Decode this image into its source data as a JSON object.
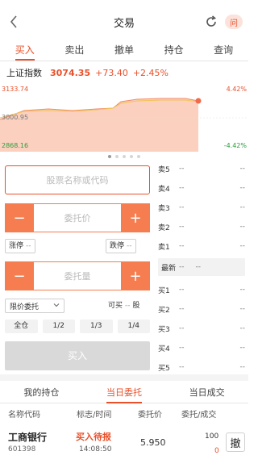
{
  "nav": {
    "title": "交易",
    "help_label": "问"
  },
  "tabs": [
    "买入",
    "卖出",
    "撤单",
    "持仓",
    "查询"
  ],
  "index": {
    "name": "上证指数",
    "value": "3074.35",
    "change": "+73.40",
    "percent": "+2.45%"
  },
  "chart_labels": {
    "y_top": "3133.74",
    "y_mid": "3000.95",
    "y_bottom": "2868.16",
    "pct_top": "4.42%",
    "pct_bottom": "-4.42%"
  },
  "form": {
    "stock_placeholder": "股票名称或代码",
    "price_placeholder": "委托价",
    "limit_up_label": "涨停",
    "limit_up_value": "--",
    "limit_down_label": "跌停",
    "limit_down_value": "--",
    "qty_placeholder": "委托量",
    "order_type": "限价委托",
    "can_buy_label": "可买",
    "can_buy_value": "--",
    "can_buy_unit": "股",
    "quick": [
      "全仓",
      "1/2",
      "1/3",
      "1/4"
    ],
    "buy_label": "买入"
  },
  "orderbook": {
    "sell": [
      {
        "n": "卖5",
        "p": "--",
        "v": "--"
      },
      {
        "n": "卖4",
        "p": "--",
        "v": "--"
      },
      {
        "n": "卖3",
        "p": "--",
        "v": "--"
      },
      {
        "n": "卖2",
        "p": "--",
        "v": "--"
      },
      {
        "n": "卖1",
        "p": "--",
        "v": "--"
      }
    ],
    "latest_label": "最新",
    "latest_v1": "--",
    "latest_v2": "--",
    "buy": [
      {
        "n": "买1",
        "p": "--",
        "v": "--"
      },
      {
        "n": "买2",
        "p": "--",
        "v": "--"
      },
      {
        "n": "买3",
        "p": "--",
        "v": "--"
      },
      {
        "n": "买4",
        "p": "--",
        "v": "--"
      },
      {
        "n": "买5",
        "p": "--",
        "v": "--"
      }
    ]
  },
  "bottom_tabs": [
    "我的持仓",
    "当日委托",
    "当日成交"
  ],
  "table_head": [
    "名称代码",
    "标志/时间",
    "委托价",
    "委托/成交"
  ],
  "order": {
    "name": "工商银行",
    "code": "601398",
    "flag": "买入待报",
    "time": "14:08:50",
    "price": "5.950",
    "qty_ordered": "100",
    "qty_filled": "0",
    "cancel_label": "撤"
  },
  "colors": {
    "accent": "#e8502a",
    "stepper": "#f57d4f"
  }
}
